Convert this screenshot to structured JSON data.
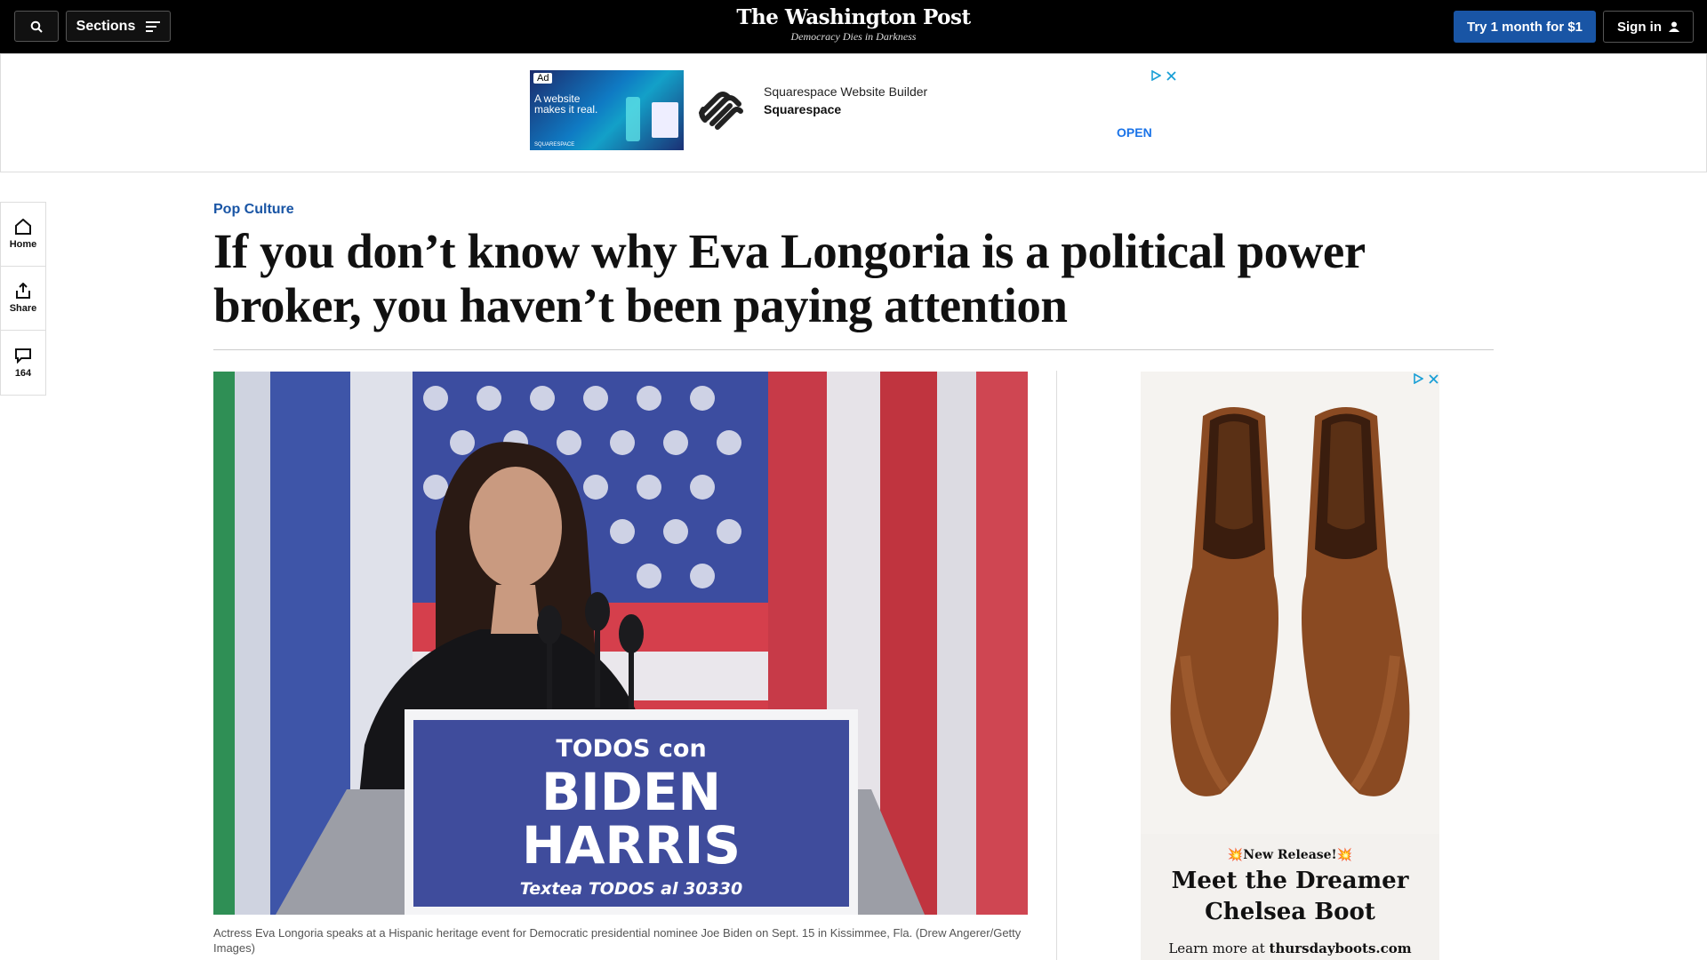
{
  "topbar": {
    "sections_label": "Sections",
    "logo_title": "The Washington Post",
    "logo_tagline": "Democracy Dies in Darkness",
    "try_label": "Try 1 month for $1",
    "signin_label": "Sign in"
  },
  "top_ad": {
    "ad_badge": "Ad",
    "thumb_text": "A website makes it real.",
    "thumb_footer": "SQUARESPACE",
    "line1": "Squarespace Website Builder",
    "line2": "Squarespace",
    "cta": "OPEN"
  },
  "rail": {
    "home": "Home",
    "share": "Share",
    "comments": "164"
  },
  "article": {
    "kicker": "Pop Culture",
    "headline": "If you don’t know why Eva Longoria is a political power broker, you haven’t been paying attention",
    "caption": "Actress Eva Longoria speaks at a Hispanic heritage event for Democratic presidential nominee Joe Biden on Sept. 15 in Kissimmee, Fla. (Drew Angerer/Getty Images)",
    "sign_line1": "TODOS con",
    "sign_line2": "BIDEN",
    "sign_line3": "HARRIS",
    "sign_line4": "Textea TODOS al 30330"
  },
  "side_ad": {
    "new_release": "💥New Release!💥",
    "meet_line1": "Meet the Dreamer",
    "meet_line2": "Chelsea Boot",
    "learn_prefix": "Learn more at ",
    "learn_site": "thursdayboots.com"
  },
  "colors": {
    "accent_blue": "#1955a5",
    "topbar_bg": "#000000"
  }
}
